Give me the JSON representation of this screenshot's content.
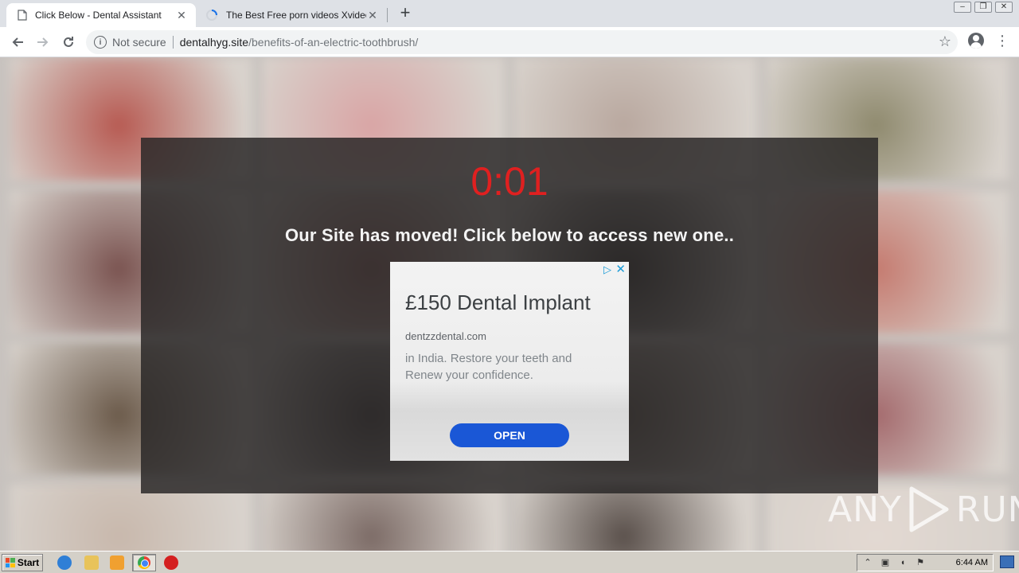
{
  "browser": {
    "tabs": [
      {
        "title": "Click Below - Dental Assistant",
        "active": true
      },
      {
        "title": "The Best Free porn videos Xvideos",
        "active": false,
        "loading": true
      }
    ],
    "new_tab_label": "+",
    "window_controls": {
      "minimize": "–",
      "restore": "❐",
      "close": "✕"
    },
    "omnibox": {
      "security_label": "Not secure",
      "domain": "dentalhyg.site",
      "path": "/benefits-of-an-electric-toothbrush/"
    }
  },
  "page": {
    "countdown": "0:01",
    "message": "Our Site has moved! Click below to access new one..",
    "background_tile_colors": [
      "#b75a52",
      "#d9a5a5",
      "#b9a89f",
      "#8f8a6e",
      "#7a5350",
      "#9a6a66",
      "#3d3936",
      "#c57a6f",
      "#6b5a4a",
      "#4c4545",
      "#6e6258",
      "#a46a6d",
      "#c8b8ac",
      "#7c6b66",
      "#5a504b",
      "#e3d9d2"
    ]
  },
  "ad": {
    "headline": "£150 Dental Implant",
    "domain": "dentzzdental.com",
    "body": "in India. Restore your teeth and Renew your confidence.",
    "cta": "OPEN",
    "choices_icon": "adchoices-icon",
    "close_icon": "close-icon",
    "accent_color": "#1a57d6"
  },
  "watermark": {
    "left": "ANY",
    "right": "RUN"
  },
  "taskbar": {
    "start_label": "Start",
    "clock": "6:44 AM"
  }
}
